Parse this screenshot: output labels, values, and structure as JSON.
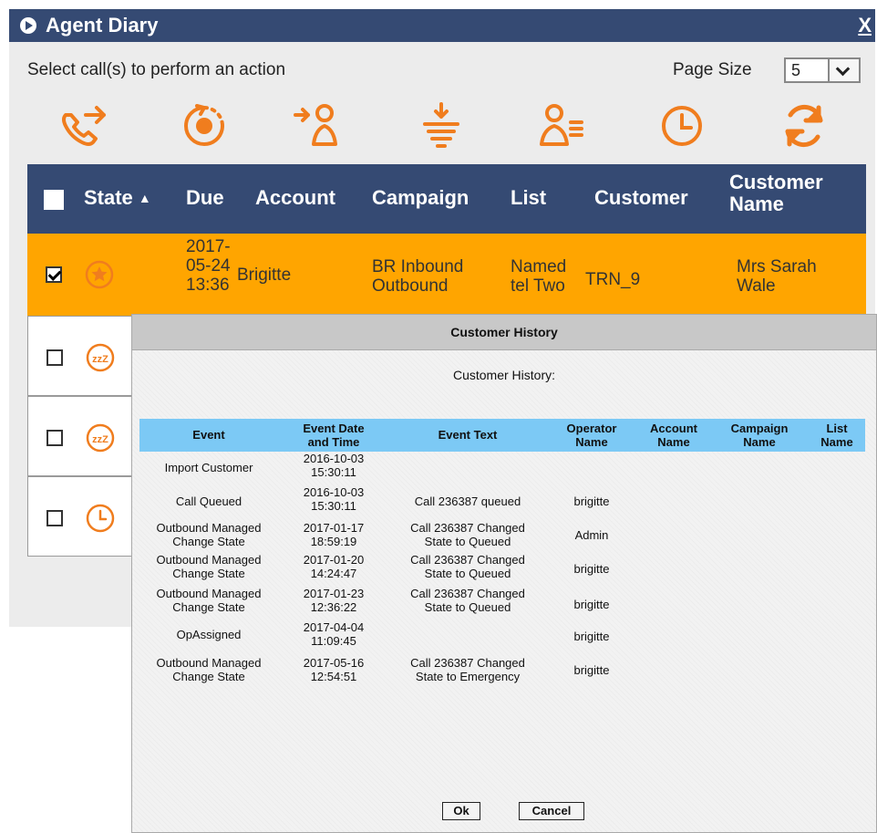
{
  "window": {
    "title": "Agent Diary",
    "close_label": "X"
  },
  "instruction": "Select call(s) to perform an action",
  "page_size": {
    "label": "Page Size",
    "value": "5"
  },
  "toolbar": [
    "transfer-call-icon",
    "snooze-timer-icon",
    "assign-agent-icon",
    "priority-down-icon",
    "agent-list-icon",
    "schedule-clock-icon",
    "refresh-icon"
  ],
  "accent_color": "#f07d1e",
  "header_color": "#354a73",
  "selected_row_color": "#ffa500",
  "columns": {
    "state": "State",
    "sort_arrow": "▲",
    "due": "Due",
    "account": "Account",
    "campaign": "Campaign",
    "list": "List",
    "customer": "Customer",
    "customer_name_1": "Customer",
    "customer_name_2": "Name"
  },
  "rows": [
    {
      "selected": true,
      "state_icon": "star-icon",
      "due_1": "2017-",
      "due_2": "05-24",
      "due_3": "13:36",
      "account": "Brigitte",
      "campaign_1": "BR Inbound",
      "campaign_2": "Outbound",
      "list_1": "Named",
      "list_2": "tel Two",
      "customer": "TRN_9",
      "customer_name_1": "Mrs Sarah",
      "customer_name_2": "Wale"
    },
    {
      "selected": false,
      "state_icon": "snooze-icon"
    },
    {
      "selected": false,
      "state_icon": "snooze-icon"
    },
    {
      "selected": false,
      "state_icon": "clock-icon"
    }
  ],
  "dialog": {
    "title": "Customer History",
    "heading": "Customer History:",
    "columns": {
      "event": "Event",
      "datetime_1": "Event Date",
      "datetime_2": "and Time",
      "text": "Event Text",
      "operator_1": "Operator",
      "operator_2": "Name",
      "account_1": "Account",
      "account_2": "Name",
      "campaign_1": "Campaign",
      "campaign_2": "Name",
      "list_1": "List",
      "list_2": "Name"
    },
    "rows": [
      {
        "event_1": "Import Customer",
        "event_2": "",
        "date": "2016-10-03",
        "time": "15:30:11",
        "text_1": "",
        "text_2": "",
        "operator": ""
      },
      {
        "event_1": "Call Queued",
        "event_2": "",
        "date": "2016-10-03",
        "time": "15:30:11",
        "text_1": "Call 236387 queued",
        "text_2": "",
        "operator": "brigitte"
      },
      {
        "event_1": "Outbound Managed",
        "event_2": "Change State",
        "date": "2017-01-17",
        "time": "18:59:19",
        "text_1": "Call 236387 Changed",
        "text_2": "State to Queued",
        "operator": "Admin"
      },
      {
        "event_1": "Outbound Managed",
        "event_2": "Change State",
        "date": "2017-01-20",
        "time": "14:24:47",
        "text_1": "Call 236387 Changed",
        "text_2": "State to Queued",
        "operator": "brigitte"
      },
      {
        "event_1": "Outbound Managed",
        "event_2": "Change State",
        "date": "2017-01-23",
        "time": "12:36:22",
        "text_1": "Call 236387 Changed",
        "text_2": "State to Queued",
        "operator": "brigitte"
      },
      {
        "event_1": "OpAssigned",
        "event_2": "",
        "date": "2017-04-04",
        "time": "11:09:45",
        "text_1": "",
        "text_2": "",
        "operator": "brigitte"
      },
      {
        "event_1": "Outbound Managed",
        "event_2": "Change State",
        "date": "2017-05-16",
        "time": "12:54:51",
        "text_1": "Call 236387 Changed",
        "text_2": "State to Emergency",
        "operator": "brigitte"
      }
    ],
    "ok_label": "Ok",
    "cancel_label": "Cancel"
  }
}
